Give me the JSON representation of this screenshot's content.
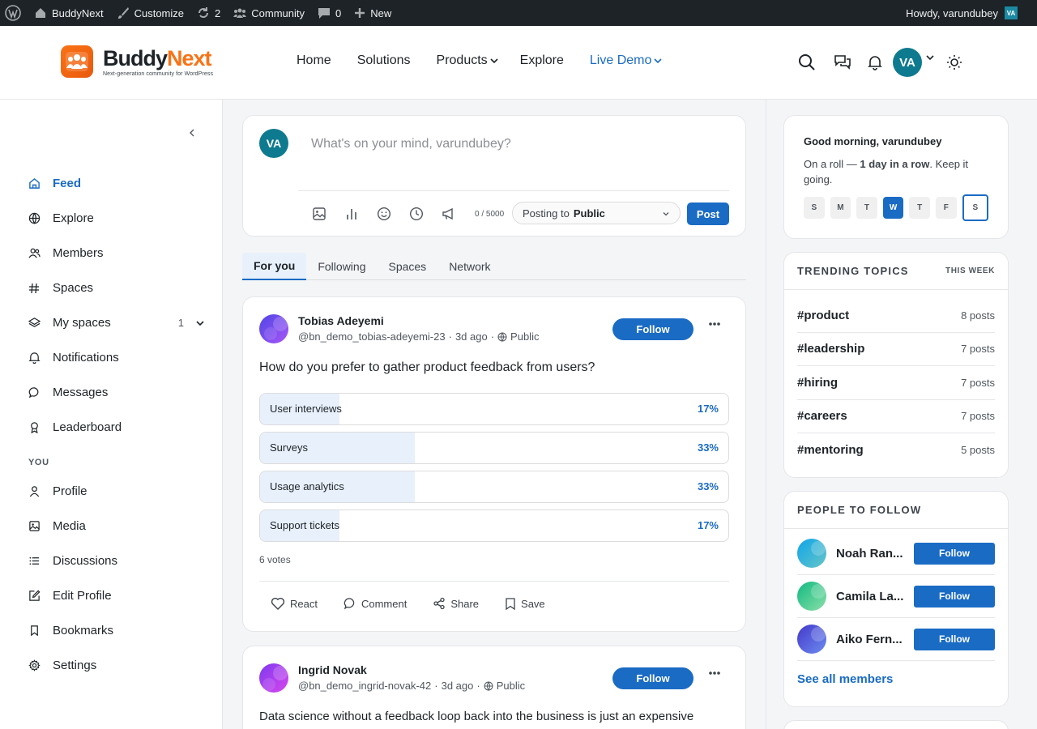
{
  "admin_bar": {
    "site_name": "BuddyNext",
    "customize": "Customize",
    "updates_count": "2",
    "community": "Community",
    "comments_count": "0",
    "new": "New",
    "howdy": "Howdy, varundubey",
    "avatar_initials": "VA"
  },
  "header": {
    "logo_part1": "Buddy",
    "logo_part2": "Next",
    "tagline": "Next-generation community for WordPress",
    "nav": [
      {
        "label": "Home"
      },
      {
        "label": "Solutions"
      },
      {
        "label": "Products"
      },
      {
        "label": "Explore"
      },
      {
        "label": "Live Demo"
      }
    ],
    "avatar_initials": "VA"
  },
  "sidebar": {
    "items": [
      {
        "label": "Feed",
        "icon": "home-icon"
      },
      {
        "label": "Explore",
        "icon": "globe-icon"
      },
      {
        "label": "Members",
        "icon": "members-icon"
      },
      {
        "label": "Spaces",
        "icon": "hash-icon"
      },
      {
        "label": "My spaces",
        "icon": "layers-icon",
        "count": "1"
      },
      {
        "label": "Notifications",
        "icon": "bell-icon"
      },
      {
        "label": "Messages",
        "icon": "chat-icon"
      },
      {
        "label": "Leaderboard",
        "icon": "award-icon"
      }
    ],
    "section_you": "YOU",
    "you_items": [
      {
        "label": "Profile",
        "icon": "user-icon"
      },
      {
        "label": "Media",
        "icon": "image-icon"
      },
      {
        "label": "Discussions",
        "icon": "list-icon"
      },
      {
        "label": "Edit Profile",
        "icon": "edit-icon"
      },
      {
        "label": "Bookmarks",
        "icon": "bookmark-icon"
      },
      {
        "label": "Settings",
        "icon": "gear-icon"
      }
    ]
  },
  "composer": {
    "avatar_initials": "VA",
    "placeholder": "What's on your mind, varundubey?",
    "counter": "0 / 5000",
    "posting_to_label": "Posting to",
    "posting_to_value": "Public",
    "post_button": "Post"
  },
  "feed_tabs": [
    {
      "label": "For you"
    },
    {
      "label": "Following"
    },
    {
      "label": "Spaces"
    },
    {
      "label": "Network"
    }
  ],
  "posts": [
    {
      "author": "Tobias Adeyemi",
      "handle": "@bn_demo_tobias-adeyemi-23",
      "time": "3d ago",
      "visibility": "Public",
      "follow": "Follow",
      "question": "How do you prefer to gather product feedback from users?",
      "poll": [
        {
          "label": "User interviews",
          "percent_text": "17%",
          "percent": 17
        },
        {
          "label": "Surveys",
          "percent_text": "33%",
          "percent": 33
        },
        {
          "label": "Usage analytics",
          "percent_text": "33%",
          "percent": 33
        },
        {
          "label": "Support tickets",
          "percent_text": "17%",
          "percent": 17
        }
      ],
      "votes": "6 votes",
      "actions": [
        "React",
        "Comment",
        "Share",
        "Save"
      ]
    },
    {
      "author": "Ingrid Novak",
      "handle": "@bn_demo_ingrid-novak-42",
      "time": "3d ago",
      "visibility": "Public",
      "follow": "Follow",
      "text": "Data science without a feedback loop back into the business is just an expensive"
    }
  ],
  "greeting": {
    "title": "Good morning, varundubey",
    "streak_prefix": "On a roll — ",
    "streak_bold": "1 day in a row",
    "streak_suffix": ". Keep it going.",
    "days": [
      "S",
      "M",
      "T",
      "W",
      "T",
      "F",
      "S"
    ]
  },
  "trending": {
    "title": "TRENDING TOPICS",
    "subtitle": "THIS WEEK",
    "topics": [
      {
        "tag": "#product",
        "count": "8 posts"
      },
      {
        "tag": "#leadership",
        "count": "7 posts"
      },
      {
        "tag": "#hiring",
        "count": "7 posts"
      },
      {
        "tag": "#careers",
        "count": "7 posts"
      },
      {
        "tag": "#mentoring",
        "count": "5 posts"
      }
    ]
  },
  "people": {
    "title": "PEOPLE TO FOLLOW",
    "list": [
      {
        "name": "Noah Ran...",
        "follow": "Follow"
      },
      {
        "name": "Camila La...",
        "follow": "Follow"
      },
      {
        "name": "Aiko Fern...",
        "follow": "Follow"
      }
    ],
    "see_all": "See all members"
  },
  "colors": {
    "accent": "#1a6bc4",
    "brand_orange": "#f97316",
    "admin_bar": "#1d2327",
    "avatar_teal": "#0e7a8f"
  }
}
